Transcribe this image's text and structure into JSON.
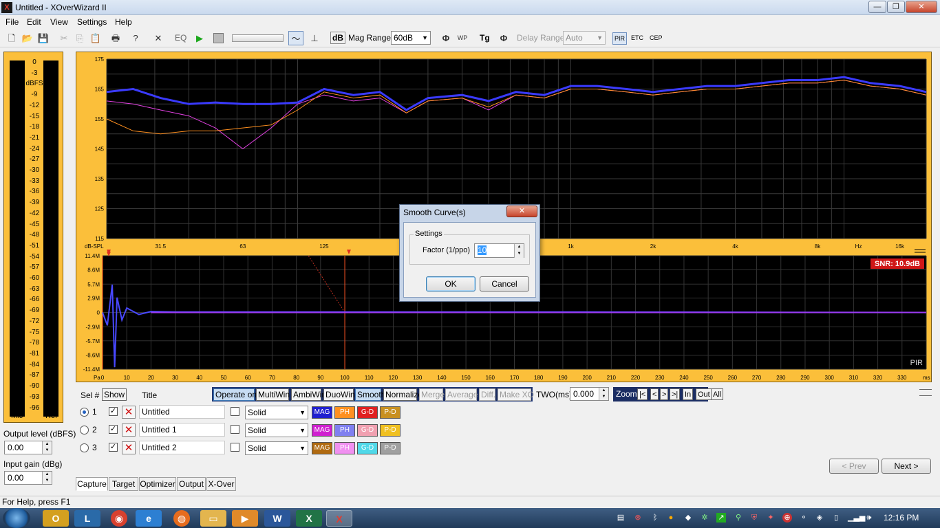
{
  "window": {
    "title": "Untitled - XOverWizard II",
    "app_icon": "X",
    "minimize": "—",
    "maximize": "❐",
    "close": "✕"
  },
  "menu": [
    "File",
    "Edit",
    "View",
    "Settings",
    "Help"
  ],
  "toolbar": {
    "eq": "EQ",
    "db": "dB",
    "mag_range_label": "Mag Range",
    "mag_range_value": "60dB",
    "delay_range_label": "Delay Range",
    "delay_range_value": "Auto",
    "pir": "PIR",
    "etc": "ETC",
    "cep": "CEP",
    "tg": "Tg",
    "wp": "WP"
  },
  "meters": {
    "ticks": [
      "0",
      "-3",
      "dBFS",
      "-9",
      "-12",
      "-15",
      "-18",
      "-21",
      "-24",
      "-27",
      "-30",
      "-33",
      "-36",
      "-39",
      "-42",
      "-45",
      "-48",
      "-51",
      "-54",
      "-57",
      "-60",
      "-63",
      "-66",
      "-69",
      "-72",
      "-75",
      "-78",
      "-81",
      "-84",
      "-87",
      "-90",
      "-93",
      "-96"
    ],
    "left_label": "Mic",
    "right_label": "Ref"
  },
  "output_level": {
    "label": "Output level (dBFS)",
    "value": "0.00"
  },
  "input_gain": {
    "label": "Input gain (dBg)",
    "value": "0.00"
  },
  "freq_chart": {
    "y_ticks": [
      "175",
      "165",
      "155",
      "145",
      "135",
      "125",
      "115"
    ],
    "x_ticks": [
      "31.5",
      "63",
      "125",
      "1k",
      "2k",
      "4k",
      "8k",
      "Hz",
      "16k"
    ],
    "y_unit": "dB-SPL"
  },
  "time_chart": {
    "y_ticks": [
      "11.4M",
      "8.6M",
      "5.7M",
      "2.9M",
      "0",
      "-2.9M",
      "-5.7M",
      "-8.6M",
      "-11.4M"
    ],
    "x_ticks": [
      "0",
      "10",
      "20",
      "30",
      "40",
      "50",
      "60",
      "70",
      "80",
      "90",
      "100",
      "110",
      "120",
      "130",
      "140",
      "150",
      "160",
      "170",
      "180",
      "190",
      "200",
      "210",
      "220",
      "230",
      "240",
      "250",
      "260",
      "270",
      "280",
      "290",
      "300",
      "310",
      "320",
      "330"
    ],
    "x_unit": "ms",
    "y_unit": "Pa",
    "snr": "SNR: 10.9dB",
    "pir_label": "PIR"
  },
  "chart_data": [
    {
      "type": "line",
      "ylim": [
        115,
        175
      ],
      "series": [
        {
          "color": "#3a3aff",
          "x": [
            20,
            25,
            31.5,
            40,
            50,
            63,
            80,
            100,
            125,
            160,
            200,
            250,
            300,
            400,
            500,
            630,
            800,
            1000,
            1250,
            1600,
            2000,
            2500,
            3150,
            4000,
            5000,
            6300,
            8000,
            10000,
            12500,
            16000,
            20000
          ],
          "y": [
            164,
            165,
            162,
            160,
            160.5,
            160,
            160,
            160.5,
            165,
            163,
            164,
            158,
            162,
            163,
            161,
            164,
            163,
            166,
            166,
            165,
            164,
            165,
            166,
            166,
            167,
            168,
            168,
            169,
            167,
            166,
            164
          ]
        },
        {
          "color": "#ff9020",
          "x": [
            20,
            25,
            31.5,
            40,
            50,
            63,
            80,
            100,
            125,
            160,
            200,
            250,
            300,
            400,
            500,
            630,
            800,
            1000,
            1250,
            1600,
            2000,
            2500,
            3150,
            4000,
            5000,
            6300,
            8000,
            10000,
            12500,
            16000,
            20000
          ],
          "y": [
            155,
            151,
            150,
            151,
            151,
            152,
            153,
            158,
            164,
            162,
            163,
            157,
            161,
            162,
            159,
            163,
            162,
            165,
            165,
            164,
            163,
            164,
            165,
            165,
            166,
            167,
            167,
            168,
            166,
            165,
            163
          ]
        },
        {
          "color": "#e040e0",
          "x": [
            20,
            25,
            31.5,
            40,
            50,
            63,
            80,
            100,
            125,
            160,
            200,
            250,
            300,
            400,
            500,
            630,
            800,
            1000,
            1250,
            1600,
            2000,
            2500,
            3150,
            4000,
            5000,
            6300,
            8000,
            10000,
            12500,
            16000,
            20000
          ],
          "y": [
            161,
            160,
            158,
            156,
            152,
            145,
            152,
            160,
            163,
            161,
            162,
            157,
            161,
            162,
            158,
            163,
            162,
            165,
            165,
            164,
            163,
            164,
            165,
            165,
            166,
            167,
            167,
            168,
            166,
            165,
            163
          ]
        }
      ]
    },
    {
      "type": "line",
      "ylim": [
        -11.4,
        11.4
      ],
      "xlim": [
        0,
        340
      ],
      "series": [
        {
          "name": "impulse",
          "color": "#4848ff",
          "x": [
            0,
            2,
            4,
            5,
            6,
            8,
            10,
            15,
            20,
            30,
            100,
            200,
            340
          ],
          "y": [
            0,
            -2.6,
            5.6,
            -11,
            3,
            -1.5,
            0.9,
            -0.4,
            0.2,
            0.1,
            0.1,
            0.1,
            0
          ]
        }
      ]
    }
  ],
  "selector": {
    "sel_label": "Sel #",
    "show": "Show",
    "title": "Title",
    "buttons": [
      "Operate on",
      "MultiWin",
      "AmbiWin",
      "DuoWin",
      "Smooth",
      "Normalize",
      "Merge",
      "Average",
      "Diff.",
      "Make XO"
    ],
    "two_label": "TWO(ms)",
    "two_value": "0.000",
    "zoom": "Zoom",
    "zoom_btns": [
      "|<",
      "<",
      ">",
      ">|",
      "In",
      "Out",
      "All"
    ]
  },
  "curves": [
    {
      "num": "1",
      "title": "Untitled",
      "style": "Solid",
      "chips": [
        {
          "t": "MAG",
          "bg": "#2020d0",
          "fg": "#ffffff"
        },
        {
          "t": "PH",
          "bg": "#ff9020",
          "fg": "#ffffff"
        },
        {
          "t": "G-D",
          "bg": "#e02020",
          "fg": "#ffffff"
        },
        {
          "t": "P-D",
          "bg": "#c89020",
          "fg": "#ffffff"
        }
      ]
    },
    {
      "num": "2",
      "title": "Untitled 1",
      "style": "Solid",
      "chips": [
        {
          "t": "MAG",
          "bg": "#d020d0",
          "fg": "#ffffff"
        },
        {
          "t": "PH",
          "bg": "#8080f0",
          "fg": "#ffffff"
        },
        {
          "t": "G-D",
          "bg": "#f0a0b0",
          "fg": "#ffffff"
        },
        {
          "t": "P-D",
          "bg": "#f0c020",
          "fg": "#ffffff"
        }
      ]
    },
    {
      "num": "3",
      "title": "Untitled 2",
      "style": "Solid",
      "chips": [
        {
          "t": "MAG",
          "bg": "#b06a10",
          "fg": "#ffffff"
        },
        {
          "t": "PH",
          "bg": "#f090f0",
          "fg": "#ffffff"
        },
        {
          "t": "G-D",
          "bg": "#50d8e8",
          "fg": "#ffffff"
        },
        {
          "t": "P-D",
          "bg": "#a0a0a0",
          "fg": "#ffffff"
        }
      ]
    }
  ],
  "nav": {
    "prev": "< Prev",
    "next": "Next >"
  },
  "tabs": [
    "Capture",
    "Target",
    "Optimizer",
    "Output",
    "X-Over"
  ],
  "status": "For Help, press F1",
  "dialog": {
    "title": "Smooth Curve(s)",
    "group": "Settings",
    "factor_label": "Factor (1/ppo)",
    "factor_value": "10",
    "ok": "OK",
    "cancel": "Cancel"
  },
  "taskbar": {
    "clock": "12:16 PM"
  }
}
